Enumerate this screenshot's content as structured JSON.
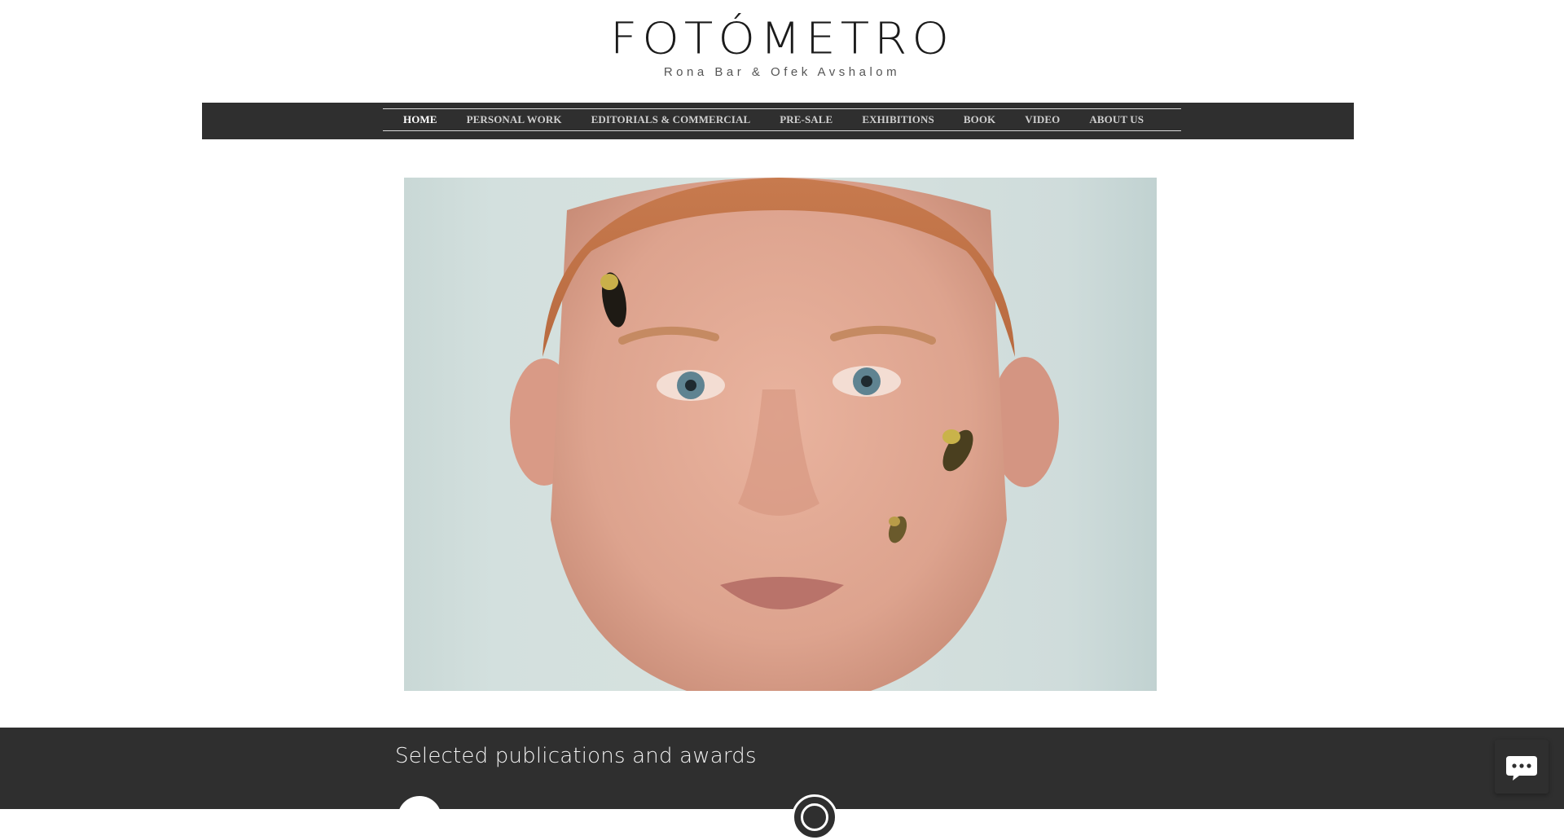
{
  "site": {
    "title": "FOTÓMETRO",
    "subtitle": "Rona Bar & Ofek Avshalom"
  },
  "nav": {
    "items": [
      {
        "label": "HOME",
        "active": true
      },
      {
        "label": "PERSONAL WORK"
      },
      {
        "label": "EDITORIALS & COMMERCIAL"
      },
      {
        "label": "PRE-SALE"
      },
      {
        "label": "EXHIBITIONS"
      },
      {
        "label": "BOOK"
      },
      {
        "label": "VIDEO"
      },
      {
        "label": "ABOUT US"
      }
    ]
  },
  "footer": {
    "heading": "Selected publications and awards"
  },
  "colors": {
    "nav_background": "#2f2f2f",
    "footer_background": "#2f2f2f",
    "nav_text": "#cfcfcf",
    "nav_active_text": "#ffffff"
  },
  "icons": {
    "chat": "chat-bubble-icon"
  }
}
